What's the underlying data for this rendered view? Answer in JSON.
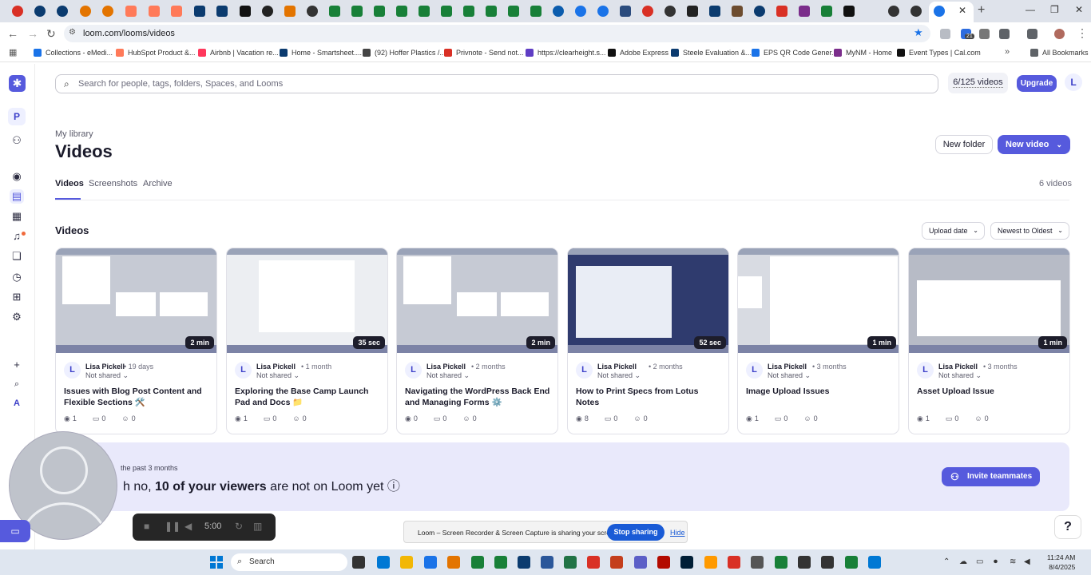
{
  "browser": {
    "url": "loom.com/looms/videos",
    "bookmarks": [
      {
        "label": "Collections - eMedi...",
        "color": "#1a73e8"
      },
      {
        "label": "HubSpot Product &...",
        "color": "#ff7a59"
      },
      {
        "label": "Airbnb | Vacation re...",
        "color": "#ff385c"
      },
      {
        "label": "Home - Smartsheet....",
        "color": "#0b3b6f"
      },
      {
        "label": "(92) Hoffer Plastics /...",
        "color": "#444444"
      },
      {
        "label": "Privnote - Send not...",
        "color": "#d93025"
      },
      {
        "label": "https://clearheight.s...",
        "color": "#5f3dc4"
      },
      {
        "label": "Adobe Express",
        "color": "#111111"
      },
      {
        "label": "Steele Evaluation &...",
        "color": "#0b3b6f"
      },
      {
        "label": "EPS QR Code Gener...",
        "color": "#1a73e8"
      },
      {
        "label": "MyNM - Home",
        "color": "#7b2d8b"
      },
      {
        "label": "Event Types | Cal.com",
        "color": "#111111"
      }
    ],
    "all_bookmarks": "All Bookmarks",
    "extension_badge": "21"
  },
  "header": {
    "search_placeholder": "Search for people, tags, folders, Spaces, and Looms",
    "quota": "6/125 videos",
    "upgrade": "Upgrade",
    "user_initial": "L",
    "workspace_initial": "P",
    "sidebar_initial": "A"
  },
  "page": {
    "breadcrumb": "My library",
    "title": "Videos",
    "new_folder": "New folder",
    "new_video": "New video",
    "tabs": [
      "Videos",
      "Screenshots",
      "Archive"
    ],
    "count": "6 videos",
    "section_title": "Videos",
    "sort_field": "Upload date",
    "sort_order": "Newest to Oldest"
  },
  "videos": [
    {
      "title": "Issues with Blog Post Content and Flexible Sections 🛠️",
      "author": "Lisa Pickell",
      "age": "• 19 days",
      "shared": "Not shared",
      "duration": "2 min",
      "views": "1",
      "comments": "0",
      "reactions": "0"
    },
    {
      "title": "Exploring the Base Camp Launch Pad and Docs 📁",
      "author": "Lisa Pickell",
      "age": "• 1 month",
      "shared": "Not shared",
      "duration": "35 sec",
      "views": "1",
      "comments": "0",
      "reactions": "0"
    },
    {
      "title": "Navigating the WordPress Back End and Managing Forms ⚙️",
      "author": "Lisa Pickell",
      "age": "• 2 months",
      "shared": "Not shared",
      "duration": "2 min",
      "views": "0",
      "comments": "0",
      "reactions": "0"
    },
    {
      "title": "How to Print Specs from Lotus Notes",
      "author": "Lisa Pickell",
      "age": "• 2 months",
      "shared": "Not shared",
      "duration": "52 sec",
      "views": "8",
      "comments": "0",
      "reactions": "0"
    },
    {
      "title": "Image Upload Issues",
      "author": "Lisa Pickell",
      "age": "• 3 months",
      "shared": "Not shared",
      "duration": "1 min",
      "views": "1",
      "comments": "0",
      "reactions": "0"
    },
    {
      "title": "Asset Upload Issue",
      "author": "Lisa Pickell",
      "age": "• 3 months",
      "shared": "Not shared",
      "duration": "1 min",
      "views": "1",
      "comments": "0",
      "reactions": "0"
    }
  ],
  "banner": {
    "subtitle": "the past 3 months",
    "prefix": "h no, ",
    "highlight": "10 of your viewers",
    "suffix": " are not on Loom yet ⓘ",
    "invite": "Invite teammates"
  },
  "recorder": {
    "time": "5:00",
    "share_text": "Loom – Screen Recorder & Screen Capture is sharing your screen.",
    "stop": "Stop sharing",
    "hide": "Hide"
  },
  "taskbar": {
    "search": "Search",
    "time": "11:24 AM",
    "date": "8/4/2025"
  },
  "colors": {
    "accent": "#565add",
    "banner": "#e9e9fb",
    "stop_button": "#1a5bd6"
  }
}
